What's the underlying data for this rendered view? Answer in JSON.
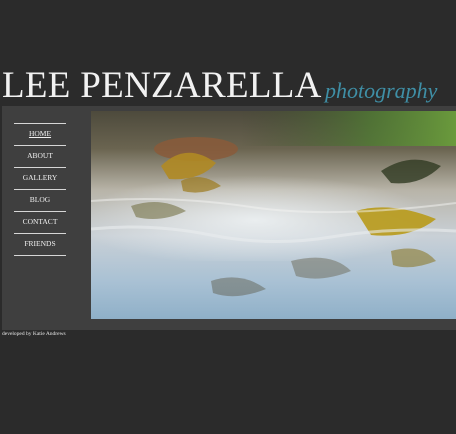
{
  "header": {
    "site_name": "LEE PENZARELLA",
    "tagline": "photography"
  },
  "nav": {
    "items": [
      {
        "label": "HOME"
      },
      {
        "label": "ABOUT"
      },
      {
        "label": "GALLERY"
      },
      {
        "label": "BLOG"
      },
      {
        "label": "CONTACT"
      },
      {
        "label": "FRIENDS"
      }
    ]
  },
  "footer": {
    "credit": "developed by Katie Andrews"
  },
  "colors": {
    "background": "#2b2b2b",
    "panel": "#3f3f3f",
    "tagline": "#3f8fa6"
  }
}
